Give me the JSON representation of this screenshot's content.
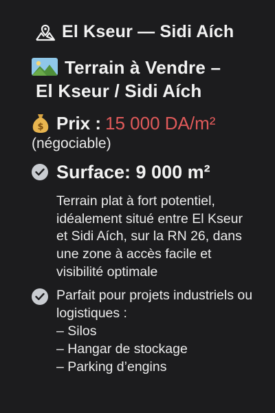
{
  "location": {
    "icon": "landscape-pin-icon",
    "label": "El Kseur — Sidi Aích"
  },
  "title": {
    "icon": "landscape-picture-icon",
    "line1": "Terrain à Vendre –",
    "line2": "El Kseur / Sidi Aích"
  },
  "price": {
    "icon": "money-bag-icon",
    "label": "Prix :",
    "value": "15 000 DA/m²",
    "note": "(négociable)",
    "value_color": "#e05a5a"
  },
  "surface": {
    "icon": "check-circle-icon",
    "label": "Surface: 9 000 m²"
  },
  "description": "Terrain plat à fort potentiel, idéalement situé entre El Kseur et Sidi Aích, sur la RN 26, dans une zone à accès facile et visibilité optimale",
  "ideal": {
    "icon": "check-circle-icon",
    "intro": "Parfait pour projets industriels ou logistiques :",
    "items": [
      "Silos",
      "Hangar de stockage",
      "Parking d’engins"
    ]
  }
}
